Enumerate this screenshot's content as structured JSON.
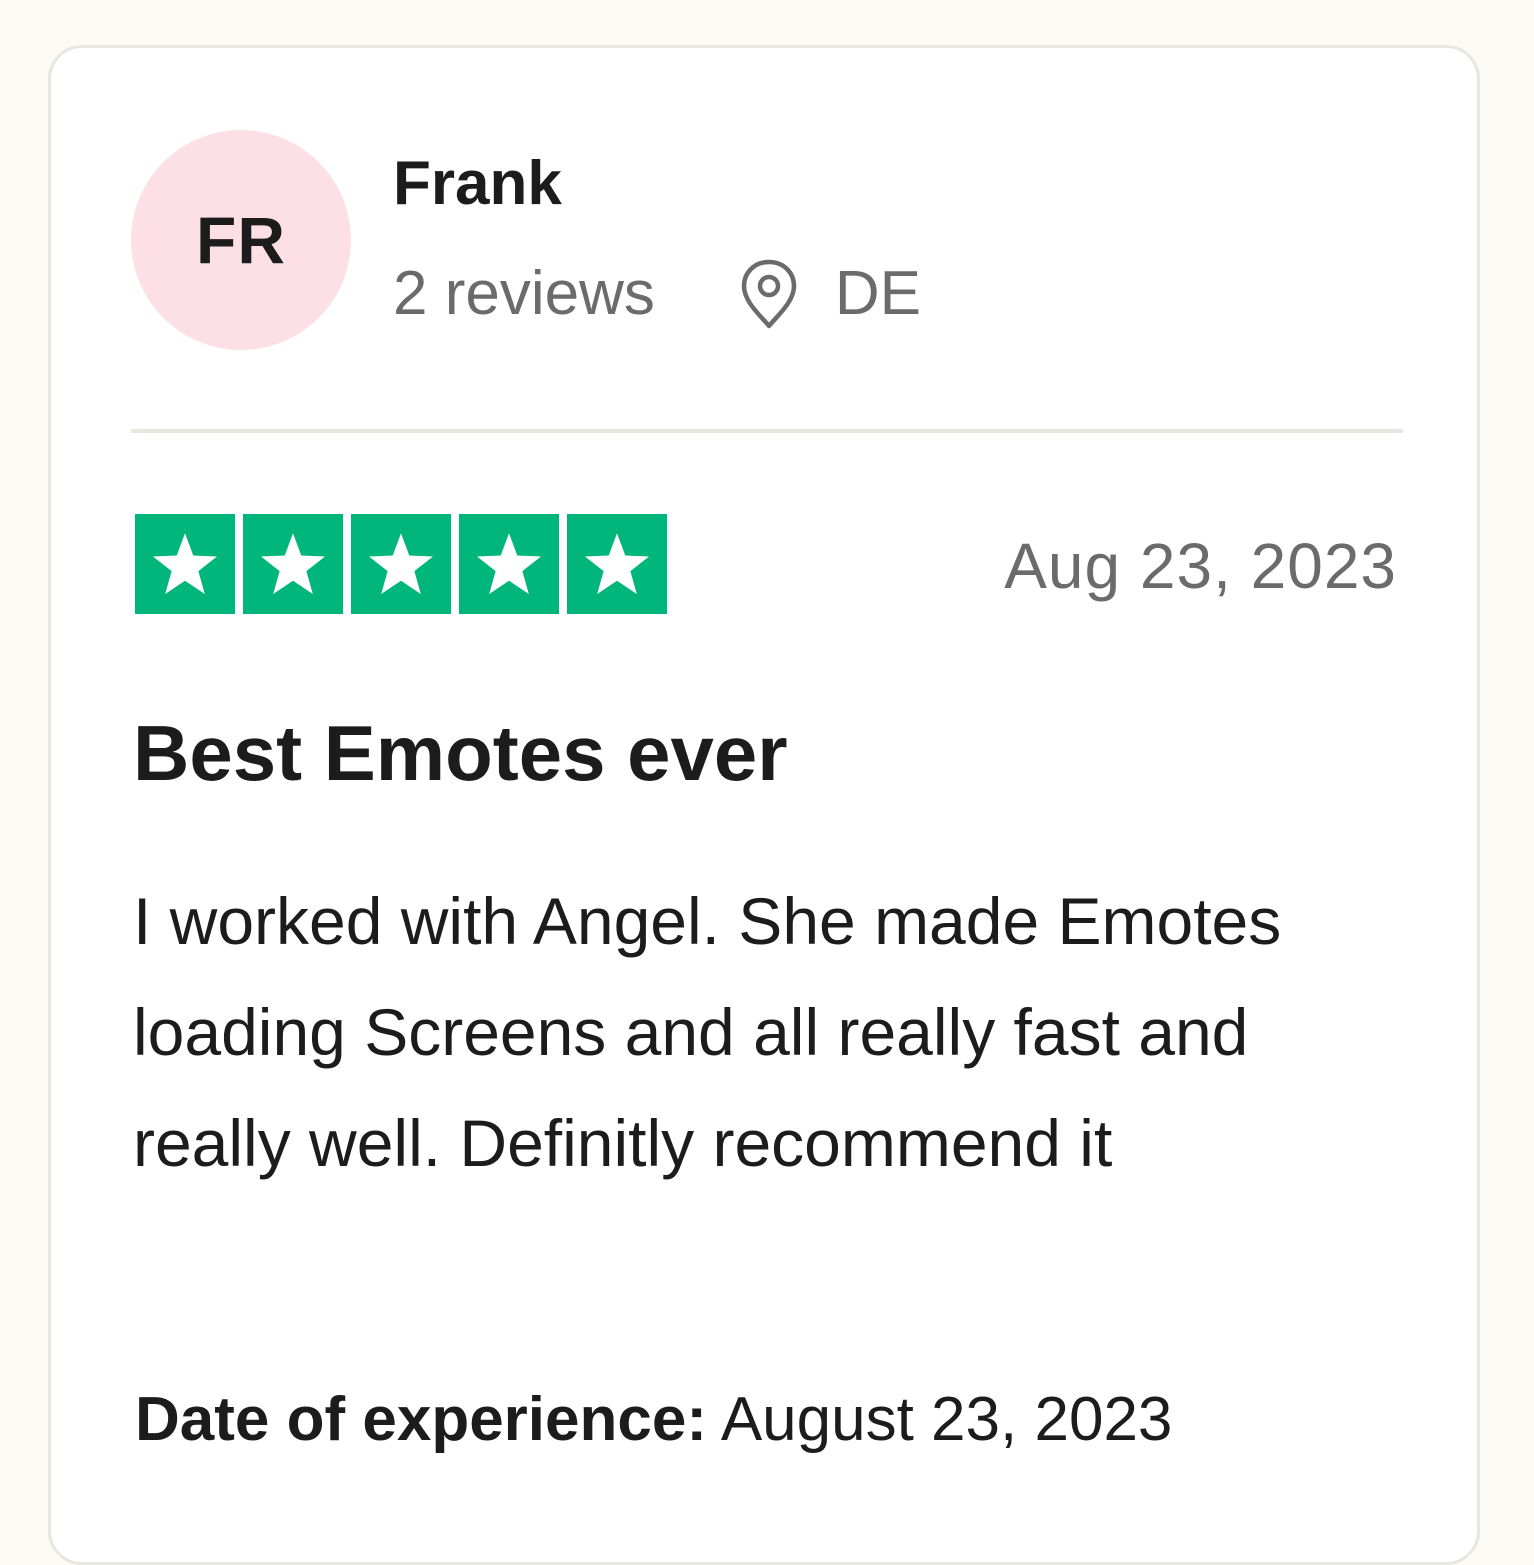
{
  "reviewer": {
    "initials": "FR",
    "name": "Frank",
    "review_count": "2 reviews",
    "country": "DE",
    "avatar_color": "#fde0e6"
  },
  "review": {
    "rating": 5,
    "max_rating": 5,
    "star_color": "#00b67a",
    "date": "Aug 23, 2023",
    "title": "Best Emotes ever",
    "body": "I worked with Angel. She made Emotes loading Screens and all really fast and really well. Definitly recommend it",
    "experience_label": "Date of experience:",
    "experience_date": "August 23, 2023"
  },
  "icons": {
    "location": "location-pin-icon",
    "star": "star-icon"
  }
}
